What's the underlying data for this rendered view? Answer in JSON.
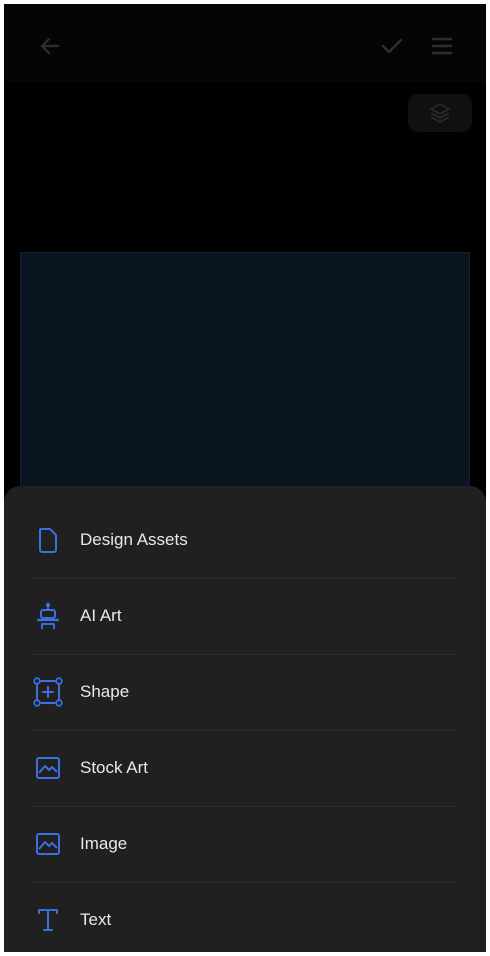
{
  "colors": {
    "accent": "#3b6fe0",
    "sheet_background": "#202020",
    "canvas_background": "#0a1522",
    "text": "#e9e9e9"
  },
  "toolbar": {
    "back_icon": "arrow-left-icon",
    "confirm_icon": "checkmark-icon",
    "menu_icon": "hamburger-menu-icon",
    "layers_icon": "layers-icon"
  },
  "add_menu": {
    "items": [
      {
        "label": "Design Assets",
        "icon": "document-icon"
      },
      {
        "label": "AI Art",
        "icon": "ai-art-icon"
      },
      {
        "label": "Shape",
        "icon": "shape-icon"
      },
      {
        "label": "Stock Art",
        "icon": "image-icon"
      },
      {
        "label": "Image",
        "icon": "image-icon"
      },
      {
        "label": "Text",
        "icon": "text-icon"
      }
    ]
  }
}
